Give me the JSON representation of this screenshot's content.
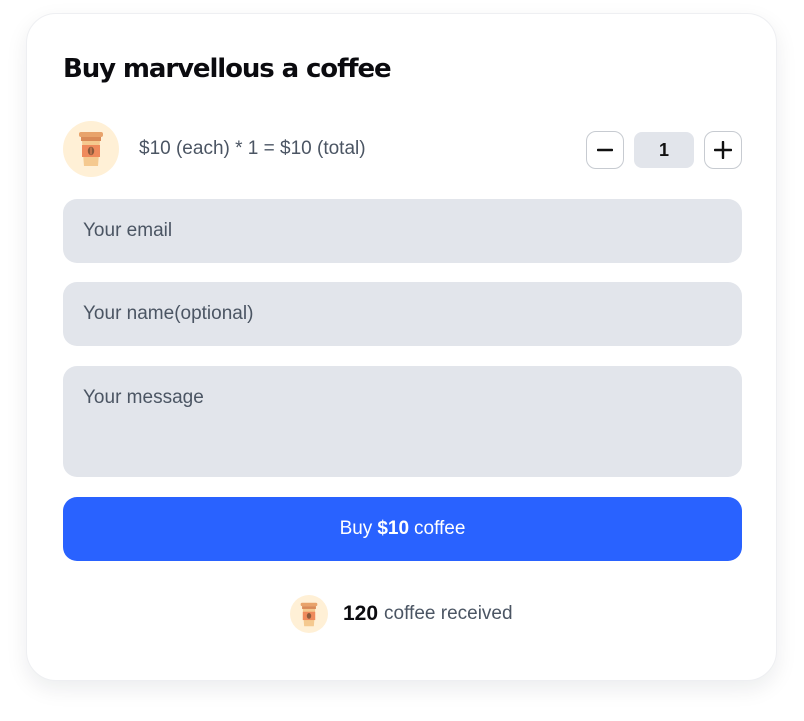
{
  "widget": {
    "title": "Buy marvellous a coffee"
  },
  "price_row": {
    "cup_icon": "coffee-cup-icon",
    "summary": "$10 (each) * 1 = $10 (total)"
  },
  "quantity": {
    "decrement_icon": "minus-icon",
    "increment_icon": "plus-icon",
    "value": "1"
  },
  "form": {
    "email_placeholder": "Your email",
    "name_placeholder": "Your name(optional)",
    "message_placeholder": "Your message"
  },
  "buy_button": {
    "prefix": "Buy",
    "amount": "$10",
    "suffix": "coffee"
  },
  "received": {
    "cup_icon": "coffee-cup-icon",
    "count": "120",
    "label": "coffee received"
  },
  "colors": {
    "accent": "#2962ff",
    "field_background": "#e2e5eb",
    "badge_background": "#fff0d6"
  }
}
